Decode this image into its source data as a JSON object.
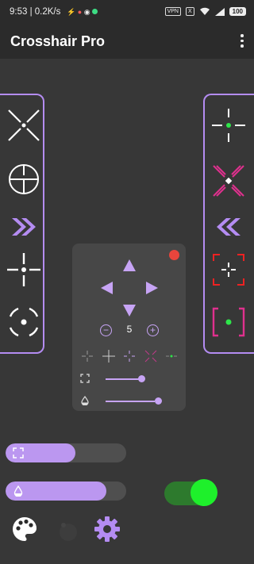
{
  "status": {
    "time_speed": "9:53 | 0.2K/s",
    "vpn": "VPN",
    "x_badge": "X",
    "battery": "100"
  },
  "app": {
    "title": "Crosshair Pro"
  },
  "left_panel": {
    "items": [
      "x-crosshair-icon",
      "scope-crosshair-icon",
      "chevrons-right-icon",
      "plus-dot-crosshair-icon",
      "circle-dot-crosshair-icon"
    ]
  },
  "right_panel": {
    "items": [
      "green-dot-cross-icon",
      "pink-x-crosshair-icon",
      "chevrons-left-icon",
      "red-bracket-cross-icon",
      "pink-bracket-green-dot-icon"
    ]
  },
  "control_panel": {
    "size_value": "5",
    "size_slider_fraction": 0.72,
    "opacity_slider_fraction": 1.0,
    "record_color": "#e8453c"
  },
  "bottom": {
    "size_bar_fraction": 0.58,
    "opacity_bar_fraction": 0.84,
    "toggle_on": true,
    "toggle_color": "#1ef02b",
    "accent": "#bb97f0"
  }
}
